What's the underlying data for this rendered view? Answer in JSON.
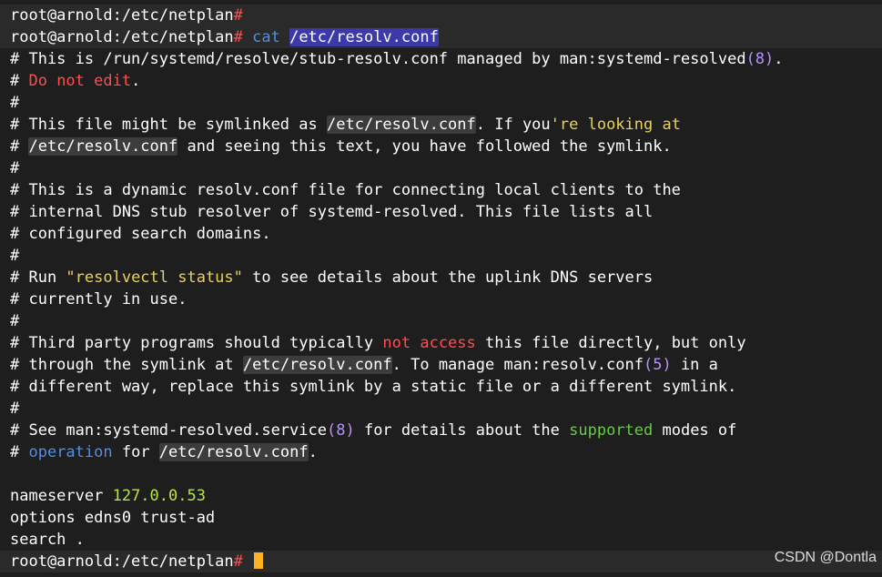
{
  "colors": {
    "background": "#1e1e1e",
    "prompt_hash": "#ff4d4d",
    "cursor": "#ffb020",
    "selection": "#3b3aa8"
  },
  "terminal": {
    "lines": [
      {
        "kind": "prompt",
        "segments": [
          {
            "t": "root@arnold:/etc/netplan"
          },
          {
            "t": "#",
            "c": "hash"
          }
        ]
      },
      {
        "kind": "prompt",
        "segments": [
          {
            "t": "root@arnold:/etc/netplan"
          },
          {
            "t": "#",
            "c": "hash"
          },
          {
            "t": " cat ",
            "c": "blue"
          },
          {
            "t": "/etc/resolv.conf",
            "c": "sel"
          }
        ]
      },
      {
        "segments": [
          {
            "t": "# This is /run/systemd/resolve/stub-resolv.conf managed by man:systemd-resolved"
          },
          {
            "t": "(8)",
            "c": "purple"
          },
          {
            "t": "."
          }
        ]
      },
      {
        "segments": [
          {
            "t": "# "
          },
          {
            "t": "Do not edit",
            "c": "red"
          },
          {
            "t": "."
          }
        ]
      },
      {
        "segments": [
          {
            "t": "#"
          }
        ]
      },
      {
        "segments": [
          {
            "t": "# This file might be symlinked as "
          },
          {
            "t": "/etc/resolv.conf",
            "c": "path"
          },
          {
            "t": ". If you"
          },
          {
            "t": "'re looking at",
            "c": "yellow"
          }
        ]
      },
      {
        "segments": [
          {
            "t": "# "
          },
          {
            "t": "/etc/resolv.conf",
            "c": "path"
          },
          {
            "t": " and seeing this text, you have followed the symlink."
          }
        ]
      },
      {
        "segments": [
          {
            "t": "#"
          }
        ]
      },
      {
        "segments": [
          {
            "t": "# This is a dynamic resolv.conf file for connecting local clients to the"
          }
        ]
      },
      {
        "segments": [
          {
            "t": "# internal DNS stub resolver of systemd-resolved. This file lists all"
          }
        ]
      },
      {
        "segments": [
          {
            "t": "# configured search domains."
          }
        ]
      },
      {
        "segments": [
          {
            "t": "#"
          }
        ]
      },
      {
        "segments": [
          {
            "t": "# Run "
          },
          {
            "t": "\"resolvectl status\"",
            "c": "yellow"
          },
          {
            "t": " to see details about the uplink DNS servers"
          }
        ]
      },
      {
        "segments": [
          {
            "t": "# currently in use."
          }
        ]
      },
      {
        "segments": [
          {
            "t": "#"
          }
        ]
      },
      {
        "segments": [
          {
            "t": "# Third party programs should typically "
          },
          {
            "t": "not access",
            "c": "red"
          },
          {
            "t": " this file directly, but only"
          }
        ]
      },
      {
        "segments": [
          {
            "t": "# through the symlink at "
          },
          {
            "t": "/etc/resolv.conf",
            "c": "path"
          },
          {
            "t": ". To manage man:resolv.conf"
          },
          {
            "t": "(5)",
            "c": "purple"
          },
          {
            "t": " in a"
          }
        ]
      },
      {
        "segments": [
          {
            "t": "# different way, replace this symlink by a static file or a different symlink."
          }
        ]
      },
      {
        "segments": [
          {
            "t": "#"
          }
        ]
      },
      {
        "segments": [
          {
            "t": "# See man:systemd-resolved.service"
          },
          {
            "t": "(8)",
            "c": "purple"
          },
          {
            "t": " for details about the "
          },
          {
            "t": "supported",
            "c": "green"
          },
          {
            "t": " modes of"
          }
        ]
      },
      {
        "segments": [
          {
            "t": "# "
          },
          {
            "t": "operation",
            "c": "blue"
          },
          {
            "t": " for "
          },
          {
            "t": "/etc/resolv.conf",
            "c": "path"
          },
          {
            "t": "."
          }
        ]
      },
      {
        "segments": [
          {
            "t": ""
          }
        ]
      },
      {
        "segments": [
          {
            "t": "nameserver "
          },
          {
            "t": "127.0.0.53",
            "c": "lime"
          }
        ]
      },
      {
        "segments": [
          {
            "t": "options edns0 trust-ad"
          }
        ]
      },
      {
        "segments": [
          {
            "t": "search ."
          }
        ]
      },
      {
        "kind": "prompt",
        "cursor": true,
        "segments": [
          {
            "t": "root@arnold:/etc/netplan"
          },
          {
            "t": "#",
            "c": "hash"
          }
        ]
      }
    ]
  },
  "watermark": "CSDN @Dontla"
}
